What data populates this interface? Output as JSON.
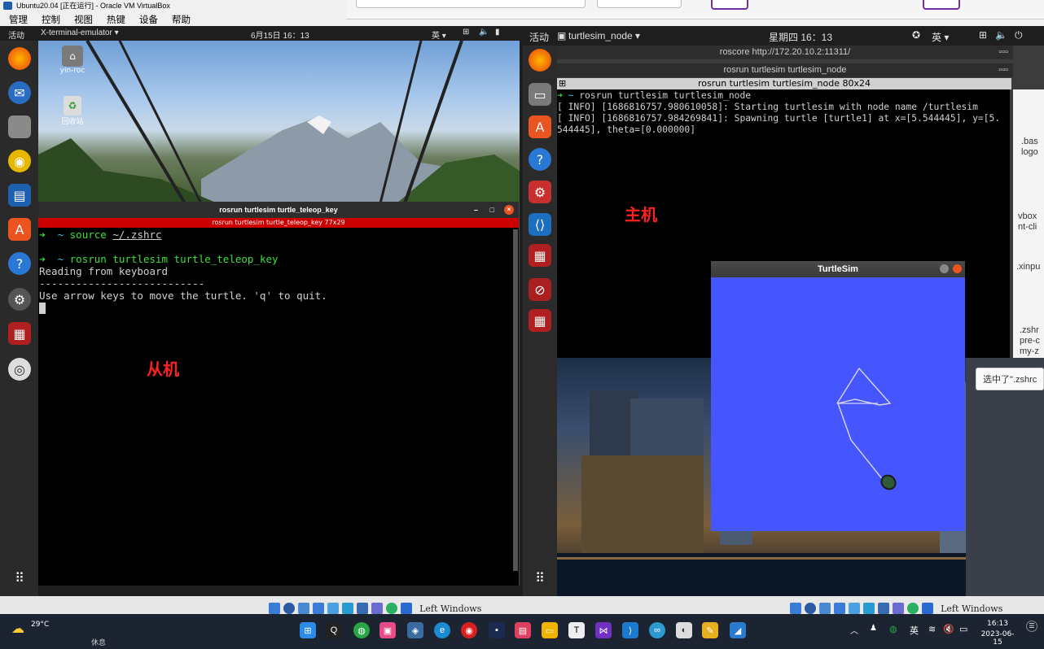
{
  "left_vm": {
    "window_title": "Ubuntu20.04 [正在运行] - Oracle VM VirtualBox",
    "menu": [
      "管理",
      "控制",
      "视图",
      "热键",
      "设备",
      "帮助"
    ],
    "topbar": {
      "activities": "活动",
      "app_name": "X-terminal-emulator ▾",
      "clock": "6月15日  16：13",
      "input_method": "英 ▾"
    },
    "desktop_icons": [
      {
        "label": "yin-roc"
      },
      {
        "label": "回收站"
      }
    ],
    "terminal": {
      "title": "rosrun turtlesim turtle_teleop_key",
      "tab_label": "rosrun turtlesim turtle_teleop_key 77x29",
      "lines": [
        {
          "arrow": "➜",
          "dir": "~",
          "cmd": " source ",
          "arg": "~/.zshrc"
        },
        {
          "arrow": "➜",
          "dir": "~",
          "cmd": " rosrun turtlesim turtle_teleop_key",
          "arg": ""
        }
      ],
      "output": [
        "Reading from keyboard",
        "---------------------------",
        "Use arrow keys to move the turtle. 'q' to quit."
      ]
    },
    "annotation": "从机",
    "host_key": "Left Windows"
  },
  "right_vm": {
    "topbar": {
      "activities": "活动",
      "app_name": "turtlesim_node ▾",
      "clock": "星期四 16：13",
      "input_method": "英 ▾"
    },
    "roscore_title": "roscore http://172.20.10.2:11311/",
    "node_window_title": "rosrun turtlesim turtlesim_node",
    "terminal": {
      "title": "rosrun turtlesim turtlesim_node 80x24",
      "prompt": {
        "arrow": "➜",
        "dir": "~",
        "cmd": " rosrun turtlesim turtlesim_node"
      },
      "output": [
        "[ INFO] [1686816757.980610058]: Starting turtlesim with node name /turtlesim",
        "[ INFO] [1686816757.984269841]: Spawning turtle [turtle1] at x=[5.544445], y=[5.",
        "544445], theta=[0.000000]"
      ]
    },
    "annotation": "主机",
    "turtlesim_title": "TurtleSim",
    "side_labels": [
      ".bas",
      "logo",
      "vbox",
      "nt-cli",
      ".xinpu",
      ".zshr",
      "pre-c",
      "my-z"
    ],
    "tooltip": "选中了\".zshrc",
    "host_key": "Left Windows"
  },
  "windows_taskbar": {
    "weather_temp": "29°C",
    "weather_text": "休息",
    "tray_input": "英",
    "time": "16:13",
    "date": "2023-06-15"
  },
  "colors": {
    "turtle_bg": "#4556ff",
    "red_tab": "#cc0000",
    "annotation": "#ff2020"
  }
}
